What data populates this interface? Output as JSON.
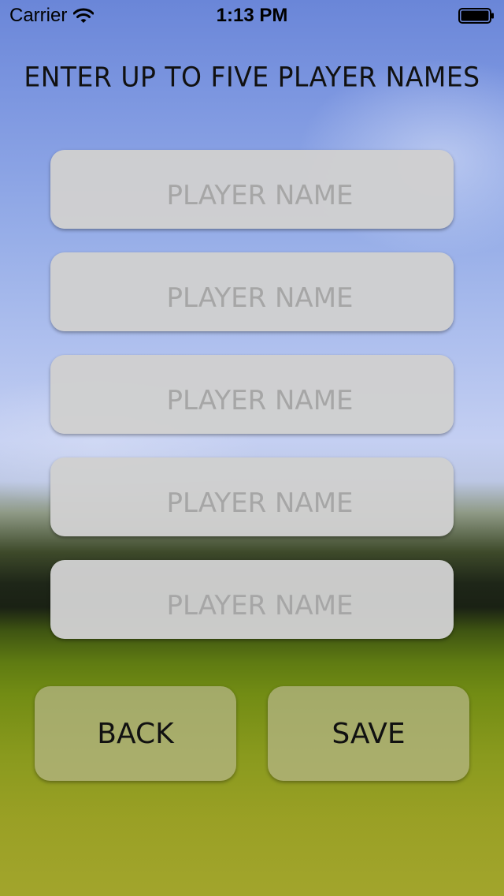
{
  "status_bar": {
    "carrier": "Carrier",
    "time": "1:13 PM",
    "wifi_icon": "wifi-icon",
    "battery_icon": "battery-icon"
  },
  "screen": {
    "title": "ENTER UP TO FIVE PLAYER NAMES"
  },
  "player_fields": [
    {
      "value": "",
      "placeholder": "PLAYER NAME"
    },
    {
      "value": "",
      "placeholder": "PLAYER NAME"
    },
    {
      "value": "",
      "placeholder": "PLAYER NAME"
    },
    {
      "value": "",
      "placeholder": "PLAYER NAME"
    },
    {
      "value": "",
      "placeholder": "PLAYER NAME"
    }
  ],
  "buttons": {
    "back_label": "BACK",
    "save_label": "SAVE"
  },
  "colors": {
    "sky": "#8aa3e4",
    "grass": "#8a9a1e",
    "field_bg": "#d0d0d0",
    "button_bg": "#b2b482"
  }
}
